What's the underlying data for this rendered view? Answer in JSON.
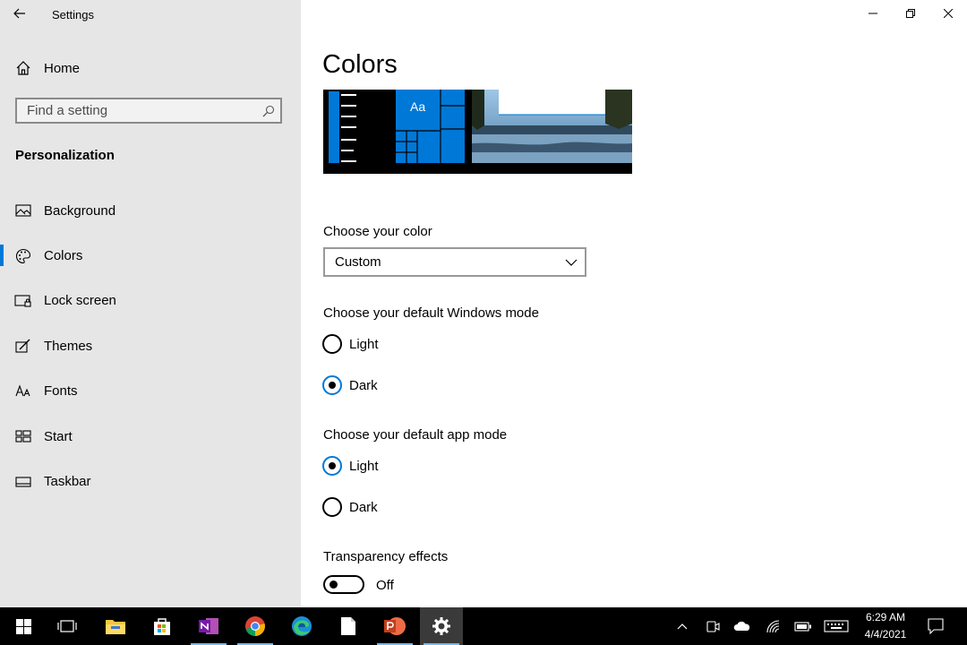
{
  "window": {
    "title": "Settings"
  },
  "sidebar": {
    "home_label": "Home",
    "search": {
      "placeholder": "Find a setting",
      "value": ""
    },
    "section_title": "Personalization",
    "items": [
      {
        "label": "Background",
        "icon": "picture-icon",
        "active": false
      },
      {
        "label": "Colors",
        "icon": "palette-icon",
        "active": true
      },
      {
        "label": "Lock screen",
        "icon": "lock-screen-icon",
        "active": false
      },
      {
        "label": "Themes",
        "icon": "brush-icon",
        "active": false
      },
      {
        "label": "Fonts",
        "icon": "font-icon",
        "active": false
      },
      {
        "label": "Start",
        "icon": "start-layout-icon",
        "active": false
      },
      {
        "label": "Taskbar",
        "icon": "taskbar-icon",
        "active": false
      }
    ]
  },
  "main": {
    "title": "Colors",
    "preview_tile_text": "Aa",
    "choose_color": {
      "label": "Choose your color",
      "value": "Custom"
    },
    "windows_mode": {
      "label": "Choose your default Windows mode",
      "options": [
        "Light",
        "Dark"
      ],
      "selected": "Dark"
    },
    "app_mode": {
      "label": "Choose your default app mode",
      "options": [
        "Light",
        "Dark"
      ],
      "selected": "Light"
    },
    "transparency": {
      "label": "Transparency effects",
      "state": "Off"
    }
  },
  "taskbar": {
    "apps": [
      "start-icon",
      "task-view-icon",
      "file-explorer-icon",
      "store-icon",
      "onenote-icon",
      "chrome-icon",
      "edge-icon",
      "file-icon",
      "powerpoint-icon",
      "settings-gear-icon"
    ],
    "clock": {
      "time": "6:29 AM",
      "date": "4/4/2021"
    }
  },
  "colors": {
    "accent": "#0078d7",
    "sidebar_bg": "#e6e6e6",
    "taskbar_bg": "#000000"
  }
}
